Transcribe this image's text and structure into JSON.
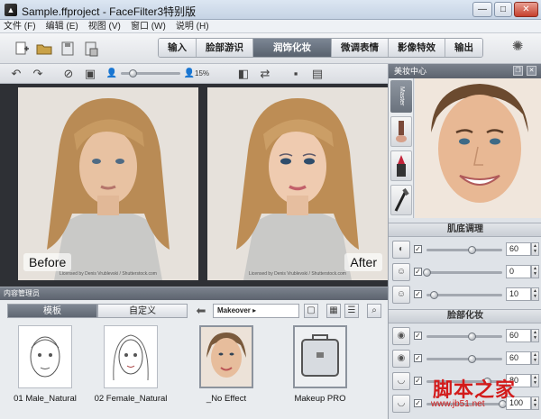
{
  "window": {
    "title": "Sample.ffproject - FaceFilter3特别版",
    "app_icon_glyph": "▲",
    "min_glyph": "—",
    "max_glyph": "□",
    "close_glyph": "✕"
  },
  "menu": [
    {
      "label": "文件 (F)"
    },
    {
      "label": "编辑 (E)"
    },
    {
      "label": "视图 (V)"
    },
    {
      "label": "窗口 (W)"
    },
    {
      "label": "说明 (H)"
    }
  ],
  "toolbar": {
    "icons": [
      "new-project-icon",
      "open-folder-icon",
      "save-icon",
      "save-as-icon"
    ]
  },
  "steps": [
    {
      "label": "输入",
      "active": false
    },
    {
      "label": "脸部游识",
      "active": false
    },
    {
      "label": "润饰化妆",
      "active": true
    },
    {
      "label": "微调表情",
      "active": false
    },
    {
      "label": "影像特效",
      "active": false
    },
    {
      "label": "输出",
      "active": false
    }
  ],
  "subtoolbar": {
    "zoom_value": "15%",
    "zoom_fraction": 0.2
  },
  "photos": {
    "before_label": "Before",
    "after_label": "After",
    "credit": "Licensed by Denis Vrublevski / Shutterstock.com"
  },
  "right_panel": {
    "title": "美妆中心",
    "master_label": "Master",
    "sections": [
      {
        "title": "肌底调理",
        "rows": [
          {
            "value": "60",
            "level": 0.6
          },
          {
            "value": "0",
            "level": 0.0
          },
          {
            "value": "10",
            "level": 0.1
          }
        ]
      },
      {
        "title": "脸部化妆",
        "rows": [
          {
            "value": "60",
            "level": 0.6
          },
          {
            "value": "60",
            "level": 0.6
          },
          {
            "value": "80",
            "level": 0.8
          },
          {
            "value": "100",
            "level": 1.0
          }
        ]
      }
    ]
  },
  "content_manager": {
    "title": "内容管理员",
    "tab_template": "模板",
    "tab_custom": "自定义",
    "category": "Makeover ▸",
    "items": [
      {
        "label": "01 Male_Natural"
      },
      {
        "label": "02 Female_Natural"
      },
      {
        "label": "_No Effect"
      },
      {
        "label": "Makeup PRO"
      }
    ]
  },
  "watermark": {
    "text": "脚本之家",
    "url": "www.jb51.net"
  }
}
